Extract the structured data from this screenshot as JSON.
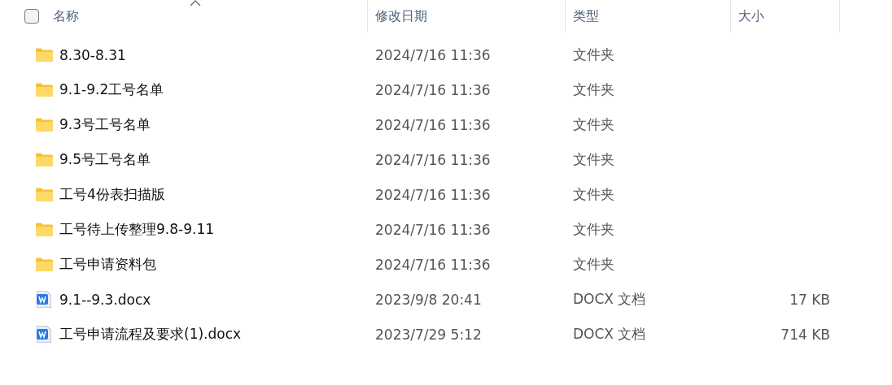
{
  "header": {
    "select_all": {
      "checked": false
    },
    "columns": [
      {
        "label": "名称",
        "sorted": true
      },
      {
        "label": "修改日期",
        "sorted": false
      },
      {
        "label": "类型",
        "sorted": false
      },
      {
        "label": "大小",
        "sorted": false
      }
    ]
  },
  "rows": [
    {
      "kind": "folder",
      "name": "8.30-8.31",
      "modified": "2024/7/16 11:36",
      "type": "文件夹"
    },
    {
      "kind": "folder",
      "name": "9.1-9.2工号名单",
      "modified": "2024/7/16 11:36",
      "type": "文件夹"
    },
    {
      "kind": "folder",
      "name": "9.3号工号名单",
      "modified": "2024/7/16 11:36",
      "type": "文件夹"
    },
    {
      "kind": "folder",
      "name": "9.5号工号名单",
      "modified": "2024/7/16 11:36",
      "type": "文件夹"
    },
    {
      "kind": "folder",
      "name": "工号4份表扫描版",
      "modified": "2024/7/16 11:36",
      "type": "文件夹"
    },
    {
      "kind": "folder",
      "name": "工号待上传整理9.8-9.11",
      "modified": "2024/7/16 11:36",
      "type": "文件夹"
    },
    {
      "kind": "folder",
      "name": "工号申请资料包",
      "modified": "2024/7/16 11:36",
      "type": "文件夹"
    },
    {
      "kind": "docx",
      "name": "9.1--9.3.docx",
      "modified": "2023/9/8 20:41",
      "type": "DOCX 文档",
      "size": "17 KB"
    },
    {
      "kind": "docx",
      "name": "工号申请流程及要求(1).docx",
      "modified": "2023/7/29 5:12",
      "type": "DOCX 文档",
      "size": "714 KB"
    }
  ]
}
